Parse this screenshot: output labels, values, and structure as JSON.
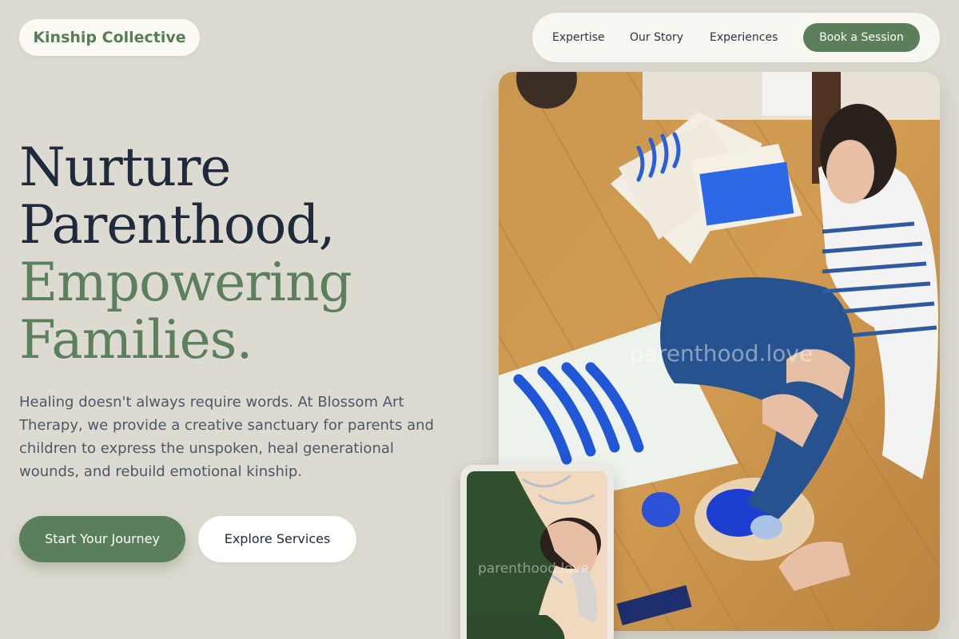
{
  "brand": {
    "name": "Kinship Collective"
  },
  "nav": {
    "links": [
      "Expertise",
      "Our Story",
      "Experiences"
    ],
    "cta": "Book a Session"
  },
  "hero": {
    "title_line1": "Nurture",
    "title_line2": "Parenthood,",
    "title_line3": "Empowering",
    "title_line4": "Families.",
    "description": "Healing doesn't always require words. At Blossom Art Therapy, we provide a creative sanctuary for parents and children to express the unspoken, heal generational wounds, and rebuild emotional kinship.",
    "primary_button": "Start Your Journey",
    "secondary_button": "Explore Services"
  },
  "images": {
    "main_watermark": "parenthood.love",
    "inset_watermark": "parenthood.love"
  },
  "colors": {
    "background": "#dddbd1",
    "accent_green": "#5a7f5a",
    "heading_dark": "#1f2a3d"
  }
}
